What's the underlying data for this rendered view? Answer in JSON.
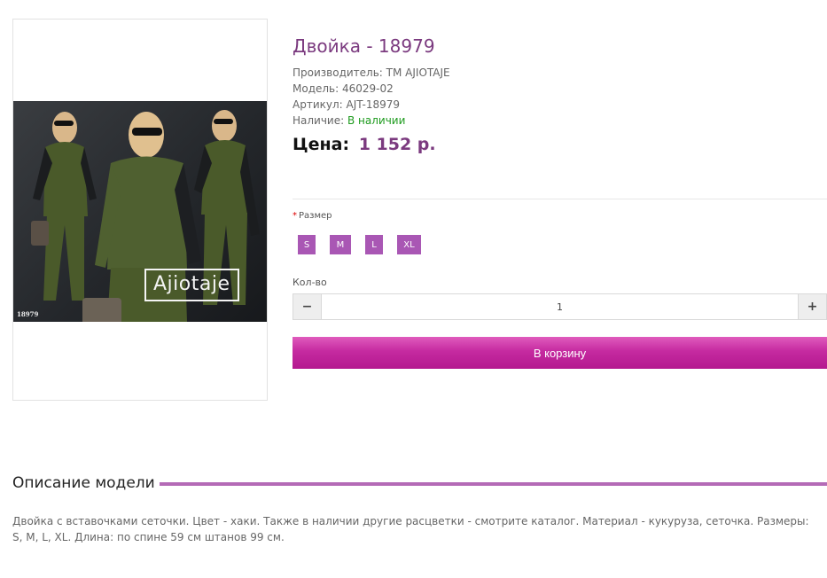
{
  "product": {
    "title": "Двойка - 18979",
    "manufacturer_label": "Производитель:",
    "manufacturer_value": "ТМ AJIOTAJE",
    "model_label": "Модель:",
    "model_value": "46029-02",
    "sku_label": "Артикул:",
    "sku_value": "AJT-18979",
    "availability_label": "Наличие:",
    "availability_value": "В наличии",
    "price_label": "Цена:",
    "price_value": "1 152 р.",
    "image_logo": "Ajiotaje",
    "image_code": "18979"
  },
  "options": {
    "size_required_mark": "*",
    "size_label": "Размер",
    "sizes": [
      "S",
      "M",
      "L",
      "XL"
    ]
  },
  "quantity": {
    "label": "Кол-во",
    "value": "1",
    "minus_icon": "minus-icon",
    "plus_icon": "plus-icon"
  },
  "cart": {
    "button_label": "В корзину"
  },
  "description": {
    "heading": "Описание модели",
    "text": "Двойка с вставочками сеточки. Цвет - хаки. Также в наличии другие расцветки - смотрите каталог. Материал - кукуруза, сеточка. Размеры: S, M, L, XL. Длина: по спине 59 см штанов 99 см."
  },
  "colors": {
    "accent": "#7b3a7f",
    "size_button": "#a957b4",
    "cart_button": "#c52aa0",
    "in_stock": "#1e9b1e",
    "description_line": "#b46ab6"
  }
}
